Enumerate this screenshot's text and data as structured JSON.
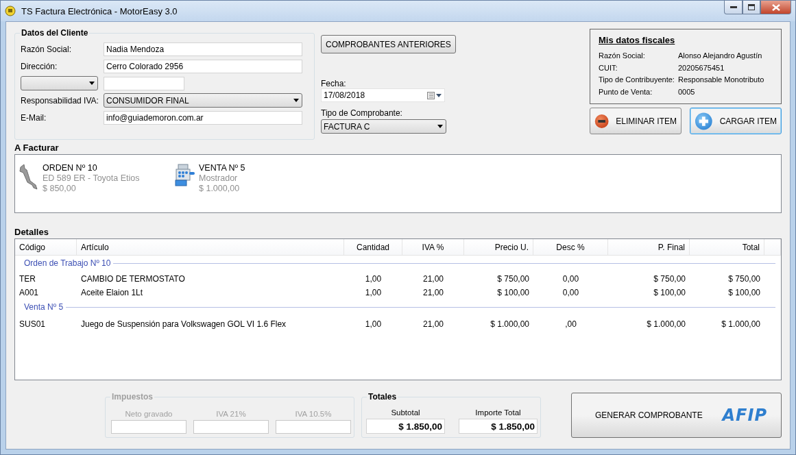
{
  "window": {
    "title": "TS Factura Electrónica - MotorEasy 3.0"
  },
  "client": {
    "title": "Datos del Cliente",
    "fields": [
      {
        "kind": "text",
        "label": "Razón Social:",
        "value": "Nadia Mendoza"
      },
      {
        "kind": "text",
        "label": "Dirección:",
        "value": "Cerro Colorado 2956"
      },
      {
        "kind": "combo_text"
      },
      {
        "kind": "select",
        "label": "Responsabilidad IVA:",
        "value": "CONSUMIDOR FINAL"
      },
      {
        "kind": "text",
        "label": "E-Mail:",
        "value": "info@guiademoron.com.ar"
      }
    ]
  },
  "previous_button": "COMPROBANTES ANTERIORES",
  "date": {
    "label": "Fecha:",
    "value": "17/08/2018"
  },
  "voucher_type": {
    "label": "Tipo de Comprobante:",
    "value": "FACTURA C"
  },
  "fiscal": {
    "title": "Mis datos fiscales",
    "rows": [
      {
        "label": "Razón Social:",
        "value": "Alonso Alejandro Agustín"
      },
      {
        "label": "CUIT:",
        "value": "20205675451"
      },
      {
        "label": "Tipo de Contribuyente:",
        "value": "Responsable Monotributo"
      },
      {
        "label": "Punto de Venta:",
        "value": "0005"
      }
    ]
  },
  "actions": [
    {
      "kind": "remove",
      "label": "ELIMINAR ITEM",
      "focused": false
    },
    {
      "kind": "add",
      "label": "CARGAR ITEM",
      "focused": true
    }
  ],
  "to_invoice": {
    "title": "A Facturar",
    "items": [
      {
        "kind": "order",
        "title": "ORDEN Nº 10",
        "subtitle": "ED 589 ER - Toyota Etios",
        "amount": "$ 850,00"
      },
      {
        "kind": "sale",
        "title": "VENTA Nº 5",
        "subtitle": "Mostrador",
        "amount": "$ 1.000,00"
      }
    ]
  },
  "details": {
    "title": "Detalles",
    "columns": [
      {
        "label": "Código"
      },
      {
        "label": "Artículo"
      },
      {
        "label": "Cantidad"
      },
      {
        "label": "IVA %"
      },
      {
        "label": "Precio U."
      },
      {
        "label": "Desc %"
      },
      {
        "label": "P. Final"
      },
      {
        "label": "Total"
      }
    ],
    "groups": [
      {
        "title": "Orden de Trabajo Nº 10",
        "rows": [
          [
            "TER",
            "CAMBIO DE TERMOSTATO",
            "1,00",
            "21,00",
            "$ 750,00",
            "0,00",
            "$ 750,00",
            "$ 750,00"
          ],
          [
            "A001",
            "Aceite Elaion 1Lt",
            "1,00",
            "21,00",
            "$ 100,00",
            "0,00",
            "$ 100,00",
            "$ 100,00"
          ]
        ]
      },
      {
        "title": "Venta Nº 5",
        "rows": [
          [
            "SUS01",
            "Juego de Suspensión para Volkswagen GOL VI 1.6 Flex",
            "1,00",
            "21,00",
            "$ 1.000,00",
            ",00",
            "$ 1.000,00",
            "$ 1.000,00"
          ]
        ]
      }
    ]
  },
  "taxes": {
    "title": "Impuestos",
    "disabled": true,
    "fields": [
      {
        "label": "Neto gravado"
      },
      {
        "label": "IVA 21%"
      },
      {
        "label": "IVA 10.5%"
      }
    ]
  },
  "totals": {
    "title": "Totales",
    "fields": [
      {
        "label": "Subtotal",
        "value": "$ 1.850,00"
      },
      {
        "label": "Importe Total",
        "value": "$ 1.850,00"
      }
    ]
  },
  "generate": {
    "label": "GENERAR COMPROBANTE",
    "logo": "AFIP"
  }
}
